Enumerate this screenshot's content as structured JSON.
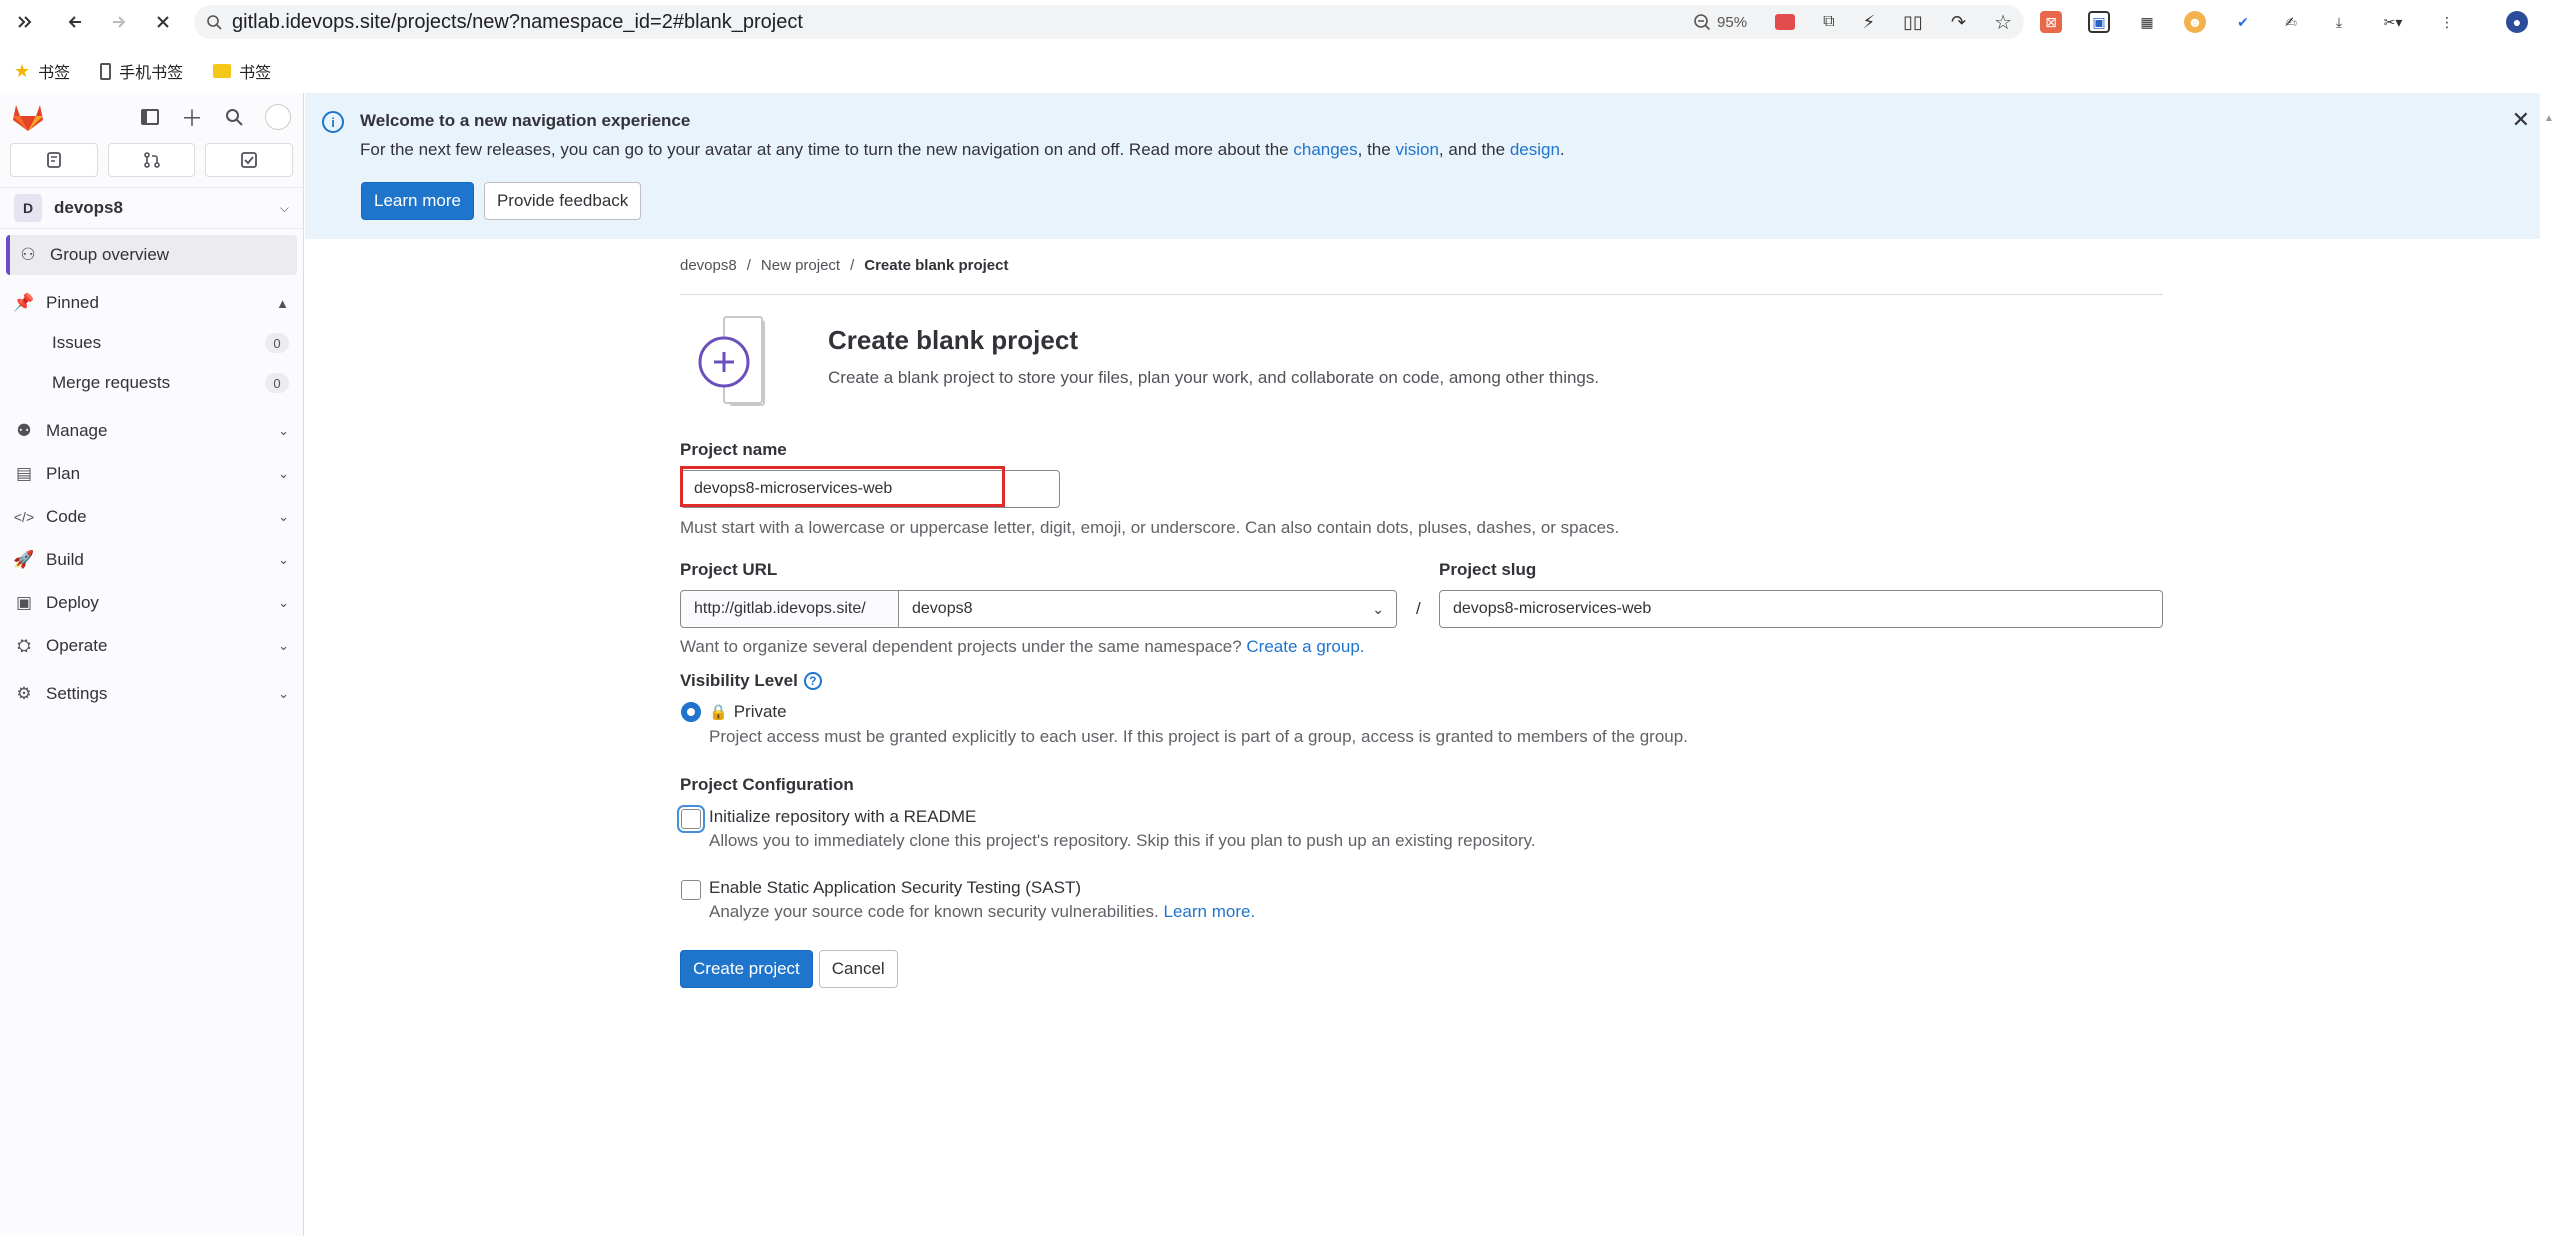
{
  "browser": {
    "url": "gitlab.idevops.site/projects/new?namespace_id=2#blank_project",
    "zoom": "95%",
    "bookmarks": [
      "书签",
      "手机书签",
      "书签"
    ]
  },
  "sidebar": {
    "counts": [
      "",
      "",
      ""
    ],
    "group_initial": "D",
    "group_name": "devops8",
    "items": [
      {
        "label": "Group overview"
      },
      {
        "label": "Pinned"
      },
      {
        "label": "Issues",
        "badge": "0"
      },
      {
        "label": "Merge requests",
        "badge": "0"
      },
      {
        "label": "Manage"
      },
      {
        "label": "Plan"
      },
      {
        "label": "Code"
      },
      {
        "label": "Build"
      },
      {
        "label": "Deploy"
      },
      {
        "label": "Operate"
      },
      {
        "label": "Settings"
      }
    ]
  },
  "banner": {
    "title": "Welcome to a new navigation experience",
    "text_before": "For the next few releases, you can go to your avatar at any time to turn the new navigation on and off. Read more about the ",
    "link_changes": "changes",
    "text_mid1": ", the ",
    "link_vision": "vision",
    "text_mid2": ", and the ",
    "link_design": "design",
    "text_end": ".",
    "learn_more": "Learn more",
    "feedback": "Provide feedback"
  },
  "breadcrumb": [
    "devops8",
    "New project",
    "Create blank project"
  ],
  "page": {
    "title": "Create blank project",
    "subtitle": "Create a blank project to store your files, plan your work, and collaborate on code, among other things."
  },
  "form": {
    "project_name_label": "Project name",
    "project_name_value": "devops8-microservices-web",
    "project_name_help": "Must start with a lowercase or uppercase letter, digit, emoji, or underscore. Can also contain dots, pluses, dashes, or spaces.",
    "project_url_label": "Project URL",
    "url_prefix": "http://gitlab.idevops.site/",
    "namespace": "devops8",
    "slash": "/",
    "project_slug_label": "Project slug",
    "project_slug_value": "devops8-microservices-web",
    "group_help": "Want to organize several dependent projects under the same namespace?",
    "create_group_link": "Create a group.",
    "visibility_label": "Visibility Level",
    "visibility_option": "Private",
    "visibility_desc": "Project access must be granted explicitly to each user. If this project is part of a group, access is granted to members of the group.",
    "config_label": "Project Configuration",
    "readme_label": "Initialize repository with a README",
    "readme_desc": "Allows you to immediately clone this project's repository. Skip this if you plan to push up an existing repository.",
    "sast_label": "Enable Static Application Security Testing (SAST)",
    "sast_desc": "Analyze your source code for known security vulnerabilities.",
    "sast_link": "Learn more.",
    "create_button": "Create project",
    "cancel_button": "Cancel"
  }
}
